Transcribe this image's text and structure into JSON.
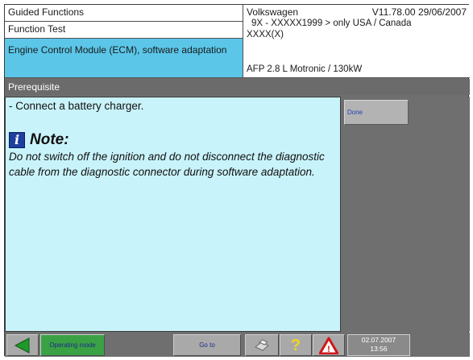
{
  "header": {
    "guided_functions": "Guided Functions",
    "function_test": "Function Test",
    "module": "Engine Control Module (ECM), software adaptation",
    "brand": "Volkswagen",
    "version": "V11.78.00 29/06/2007",
    "model_line": "9X - XXXXX1999 > only USA / Canada",
    "code": "XXXX(X)",
    "engine": "AFP 2.8 L Motronic / 130kW"
  },
  "section": {
    "title": "Prerequisite"
  },
  "content": {
    "step": "- Connect a battery charger.",
    "note_heading": "Note:",
    "note_text": " Do not switch off the ignition and do not disconnect the diagnostic cable from the diagnostic connector during software adaptation."
  },
  "side": {
    "done_label": "Done"
  },
  "toolbar": {
    "operating_mode_label": "Operating mode",
    "goto_label": "Go to",
    "date": "02.07.2007",
    "time": "13:56"
  },
  "icons": {
    "back": "back-arrow-icon",
    "print": "print-icon",
    "help": "help-icon",
    "warning": "warning-icon",
    "info": "info-icon"
  },
  "colors": {
    "module_highlight": "#5bc6e8",
    "content_background": "#c9f3fa",
    "operating_mode": "#3aa244"
  }
}
